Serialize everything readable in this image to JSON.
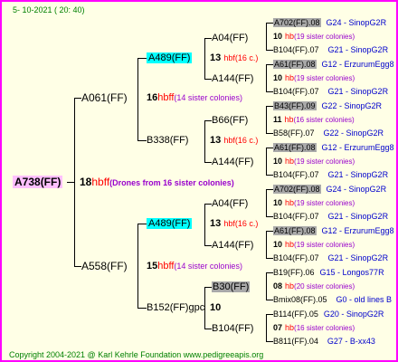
{
  "date": "5- 10-2021 ( 20: 40)",
  "copyright": "Copyright 2004-2021 @ Karl Kehrle Foundation   www.pedigreeapis.org",
  "root": {
    "name": "A738(FF)",
    "num": "18",
    "hb": "hbff",
    "note": "(Drones from 16 sister colonies)"
  },
  "gen1": [
    {
      "name": "A061(FF)",
      "num": "16",
      "hb": "hbff",
      "note": "(14 sister colonies)"
    },
    {
      "name": "A558(FF)",
      "num": "15",
      "hb": "hbff",
      "note": "(14 sister colonies)"
    }
  ],
  "gen2": [
    {
      "name": "A489(FF)",
      "num": "13",
      "hb": "hbff",
      "note": "(16 c.)"
    },
    {
      "name": "B338(FF)",
      "num": "13",
      "hb": "hbff",
      "note": "(16 c.)"
    },
    {
      "name": "A489(FF)",
      "num": "13",
      "hb": "hbff",
      "note": "(16 c.)"
    },
    {
      "name": "B152(FF)gpc",
      "num": "10",
      "hb": "",
      "note": ""
    }
  ],
  "gen3": [
    {
      "name": "A04(FF)"
    },
    {
      "name": "A144(FF)"
    },
    {
      "name": "B66(FF)"
    },
    {
      "name": "A144(FF)"
    },
    {
      "name": "A04(FF)"
    },
    {
      "name": "A144(FF)"
    },
    {
      "name": "B30(FF)"
    },
    {
      "name": "B104(FF)"
    }
  ],
  "gen4": [
    {
      "q": "A702(FF).08",
      "qsrc": "G24 - SinopG2R",
      "num": "10",
      "note": "(19 sister colonies)",
      "d": "B104(FF).07",
      "dsrc": "G21 - SinopG2R"
    },
    {
      "q": "A61(FF).08",
      "qsrc": "G12 - ErzurumEgg8",
      "num": "10",
      "note": "(19 sister colonies)",
      "d": "B104(FF).07",
      "dsrc": "G21 - SinopG2R"
    },
    {
      "q": "B43(FF).09",
      "qsrc": "G22 - SinopG2R",
      "num": "11",
      "note": "(16 sister colonies)",
      "d": "B58(FF).07",
      "dsrc": "G22 - SinopG2R"
    },
    {
      "q": "A61(FF).08",
      "qsrc": "G12 - ErzurumEgg8",
      "num": "10",
      "note": "(19 sister colonies)",
      "d": "B104(FF).07",
      "dsrc": "G21 - SinopG2R"
    },
    {
      "q": "A702(FF).08",
      "qsrc": "G24 - SinopG2R",
      "num": "10",
      "note": "(19 sister colonies)",
      "d": "B104(FF).07",
      "dsrc": "G21 - SinopG2R"
    },
    {
      "q": "A61(FF).08",
      "qsrc": "G12 - ErzurumEgg8",
      "num": "10",
      "note": "(19 sister colonies)",
      "d": "B104(FF).07",
      "dsrc": "G21 - SinopG2R"
    },
    {
      "q": "B19(FF).06",
      "qsrc": "G15 - Longos77R",
      "num": "08",
      "note": "(20 sister colonies)",
      "d": "Bmix08(FF).05",
      "dsrc": "G0 - old lines B"
    },
    {
      "q": "B114(FF).05",
      "qsrc": "G20 - SinopG2R",
      "num": "07",
      "note": "(16 sister colonies)",
      "d": "B811(FF).04",
      "dsrc": "G27 - B-xx43"
    }
  ],
  "hb_short": "hbf",
  "hb_gen4": "hb"
}
